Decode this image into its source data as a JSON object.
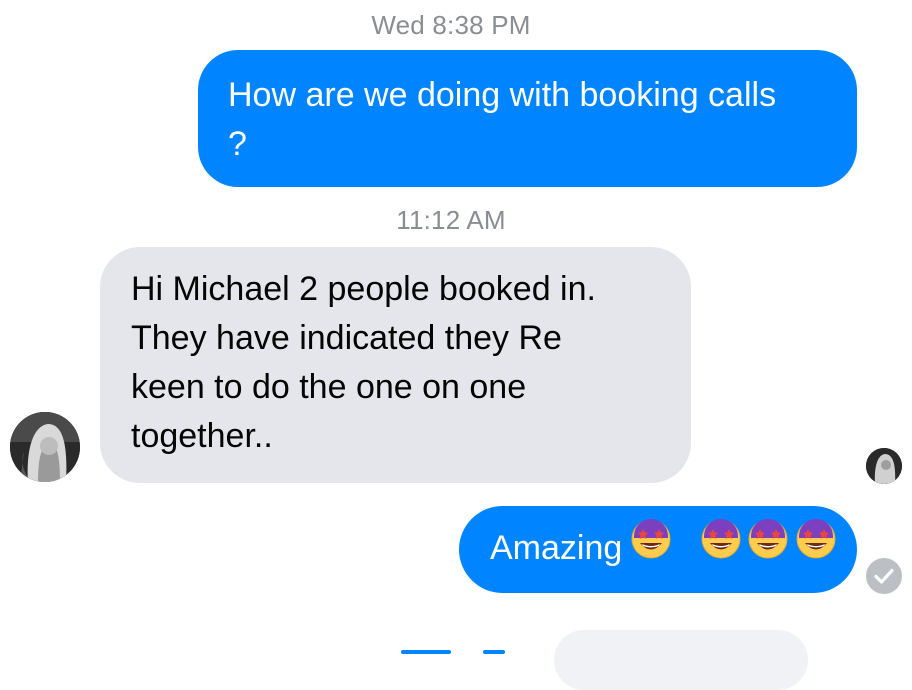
{
  "conversation": {
    "messages": [
      {
        "type": "timestamp",
        "text": "Wed 8:38 PM"
      },
      {
        "type": "outgoing",
        "lines": [
          "How are we doing with booking calls",
          "?"
        ]
      },
      {
        "type": "timestamp",
        "text": "11:12 AM"
      },
      {
        "type": "incoming",
        "lines": [
          "Hi Michael 2 people booked in.",
          "They have indicated they Re",
          "keen to do the one on one",
          "together.."
        ]
      },
      {
        "type": "outgoing",
        "text": "Amazing",
        "emoji": "star-struck",
        "emoji_count": 4
      }
    ],
    "status": {
      "seen_by": "avatar",
      "delivered": "check-icon"
    }
  },
  "colors": {
    "outgoing_bubble": "#0084ff",
    "incoming_bubble": "#e4e6eb",
    "timestamp_text": "#8a8d91",
    "status_icon": "#bcc0c4"
  }
}
